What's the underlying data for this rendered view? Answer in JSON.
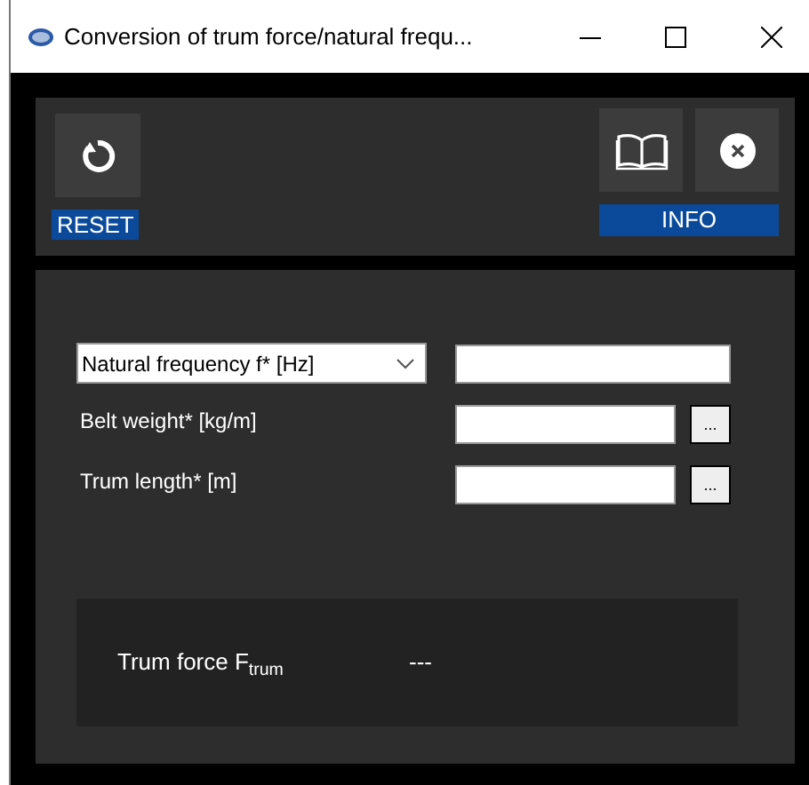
{
  "window": {
    "title": "Conversion of trum force/natural frequ..."
  },
  "toolbar": {
    "reset_label": "RESET",
    "info_label": "INFO"
  },
  "form": {
    "dropdown": {
      "value": "Natural frequency f* [Hz]"
    },
    "rows": [
      {
        "label": "Belt weight* [kg/m]",
        "button": "..."
      },
      {
        "label": "Trum length* [m]",
        "button": "..."
      }
    ]
  },
  "result": {
    "label": "Trum force F$_{trum}$",
    "value": "---"
  }
}
